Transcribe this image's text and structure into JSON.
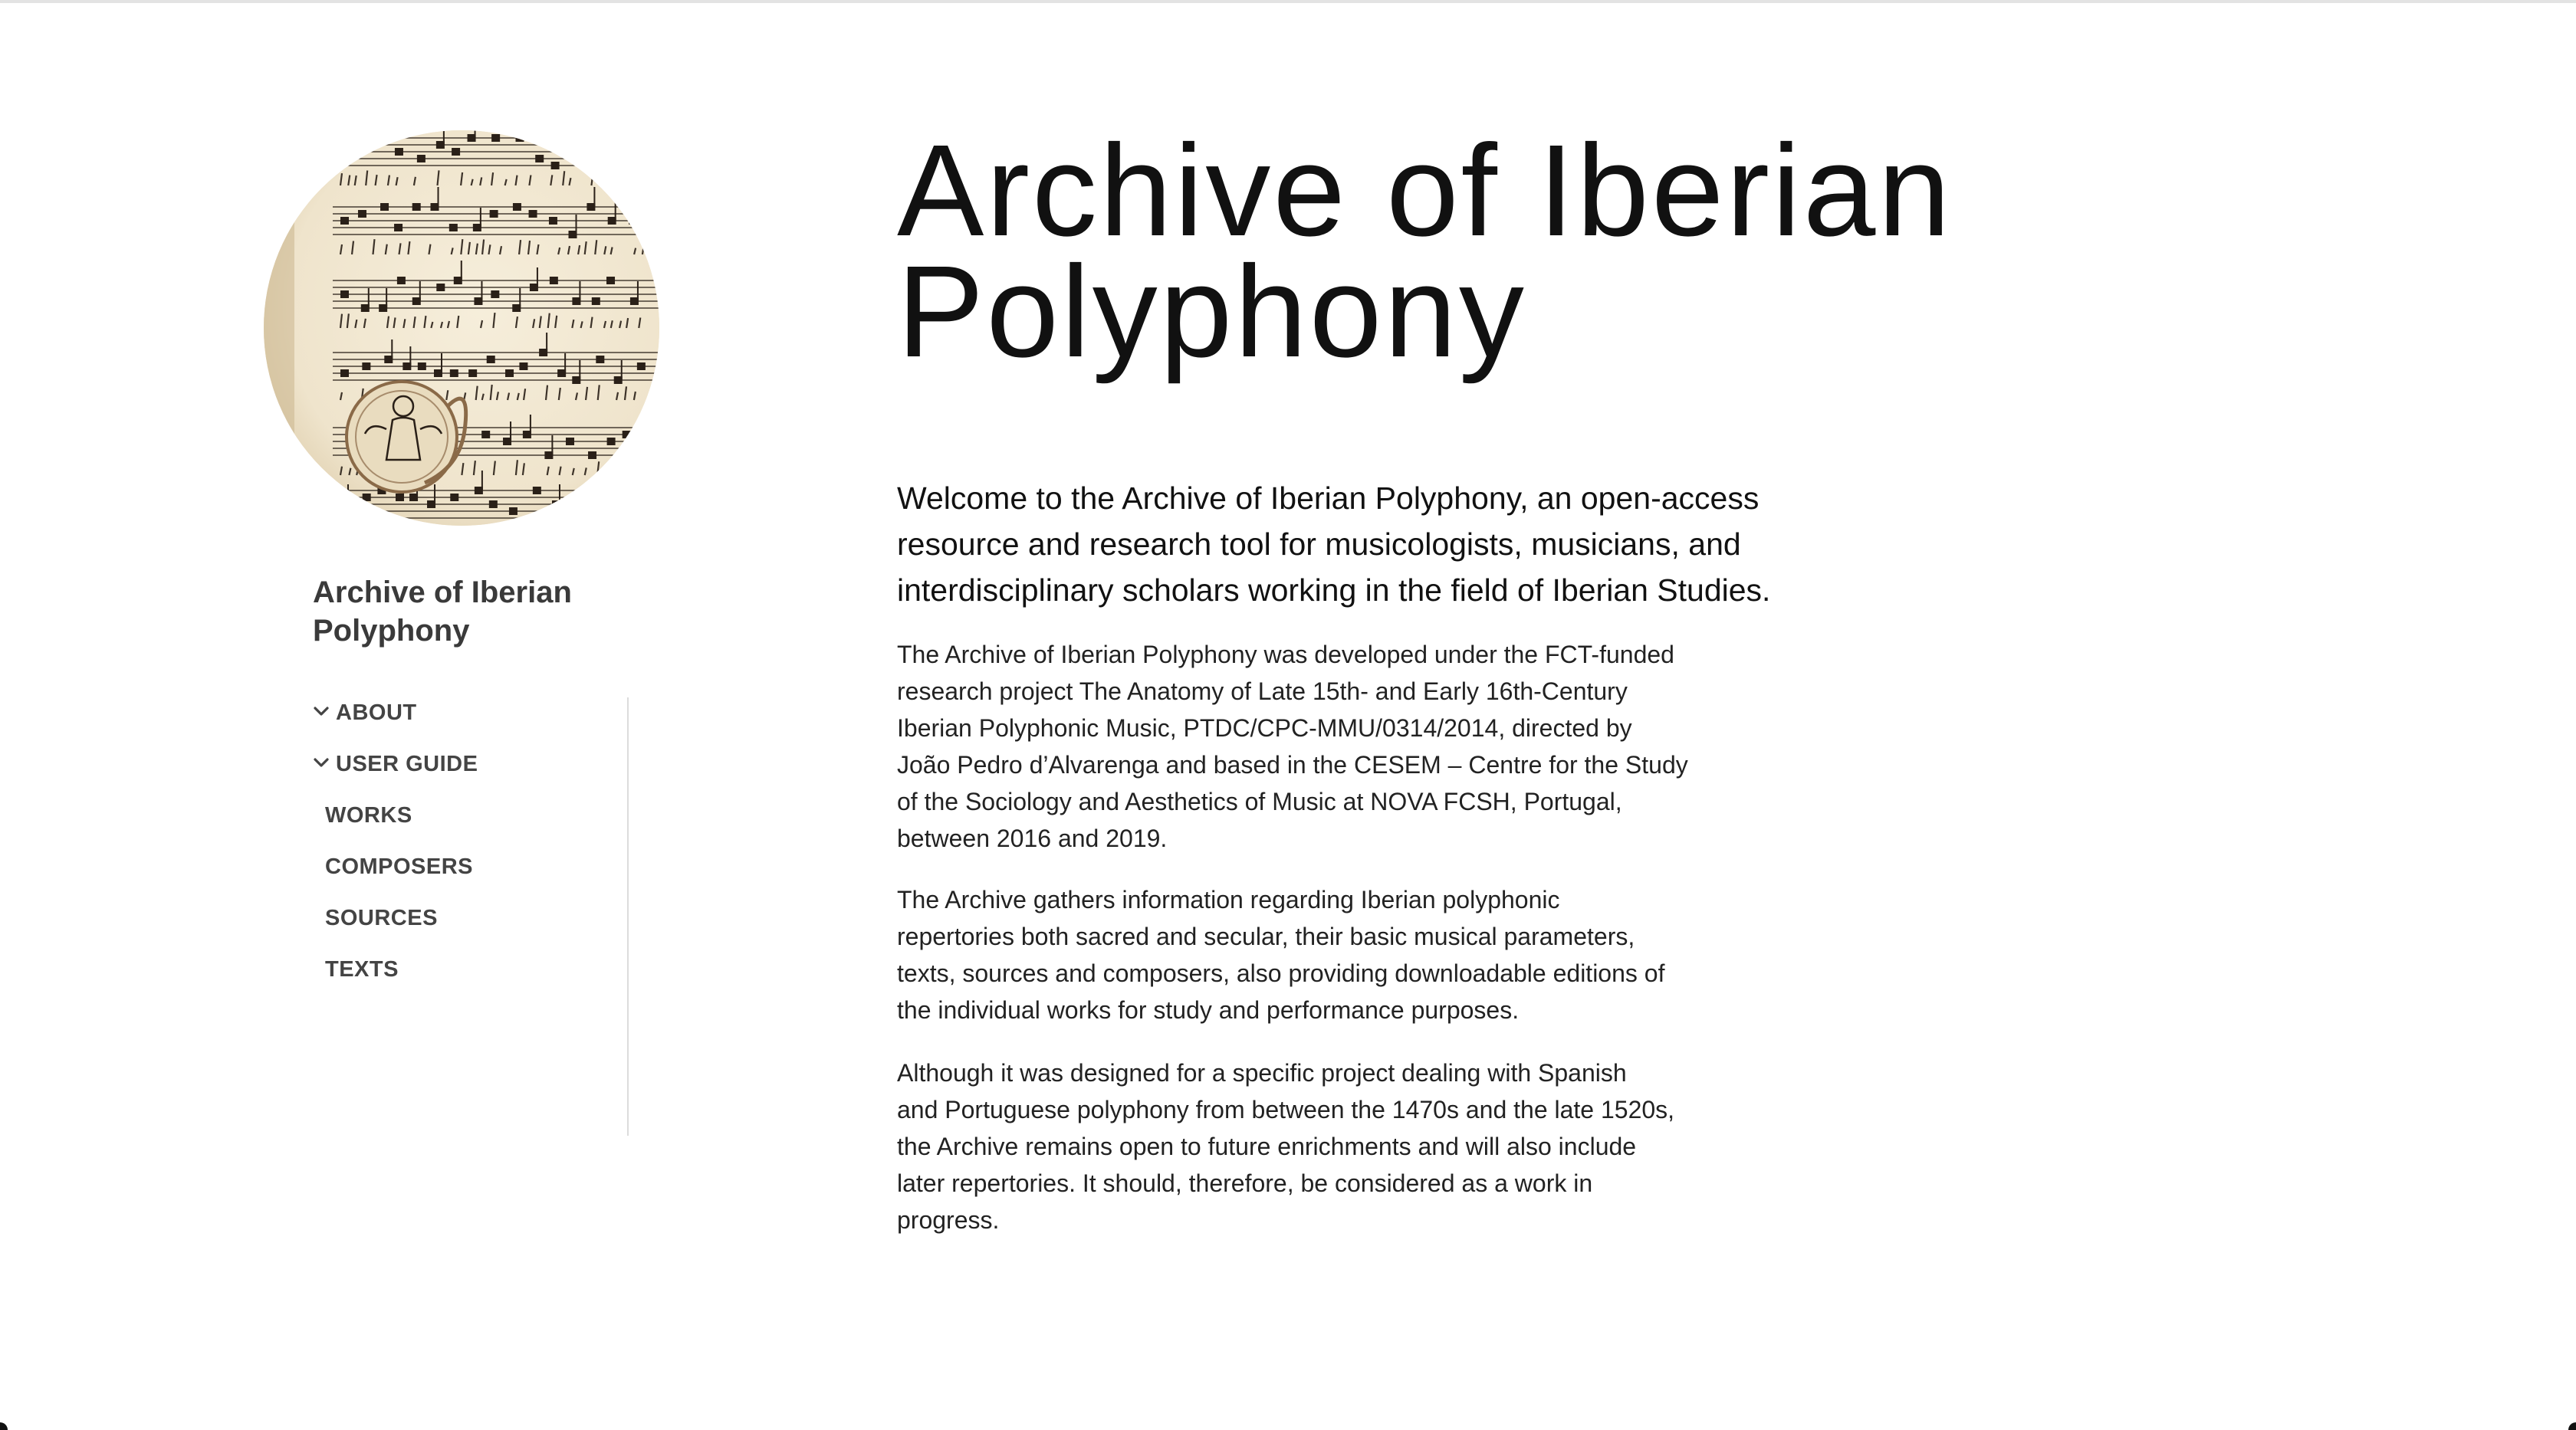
{
  "site": {
    "title_line1": "Archive of Iberian",
    "title_line2": "Polyphony"
  },
  "nav": {
    "items": [
      {
        "label": "ABOUT",
        "expanded": true,
        "icon": "chevron-down-icon"
      },
      {
        "label": "USER GUIDE",
        "expanded": true,
        "icon": "chevron-down-icon"
      },
      {
        "label": "WORKS"
      },
      {
        "label": "COMPOSERS"
      },
      {
        "label": "SOURCES"
      },
      {
        "label": "TEXTS"
      }
    ]
  },
  "main": {
    "title_line1": "Archive of Iberian",
    "title_line2": "Polyphony",
    "lead_lines": [
      "Welcome to the Archive of Iberian Polyphony, an open-access",
      "resource and research tool for musicologists, musicians, and",
      "interdisciplinary scholars working in the field of Iberian Studies."
    ],
    "p1_lines": [
      "The Archive of Iberian Polyphony was developed under the FCT-funded",
      "research project The Anatomy of Late 15th- and Early 16th-Century",
      "Iberian Polyphonic Music, PTDC/CPC-MMU/0314/2014, directed by",
      "João Pedro d’Alvarenga and based in the CESEM – Centre for the Study",
      "of the Sociology and Aesthetics of Music at NOVA FCSH, Portugal,",
      "between 2016 and 2019."
    ],
    "p2_lines": [
      "The Archive gathers information regarding Iberian polyphonic",
      "repertories both sacred and secular, their basic musical parameters,",
      "texts, sources and composers, also providing downloadable editions of",
      "the individual works for study and performance purposes."
    ],
    "p3_lines": [
      "Although it was designed for a specific project dealing with Spanish",
      "and Portuguese polyphony from between the 1470s and the late 1520s,",
      "the Archive remains open to future enrichments and will also include",
      "later repertories. It should, therefore, be considered as a work in",
      "progress."
    ]
  },
  "logo": {
    "description_icon": "music-manuscript-logo",
    "parchment_color": "#efe4cc",
    "ink_color": "#2a2018",
    "rubric_color": "#8a6a48"
  }
}
